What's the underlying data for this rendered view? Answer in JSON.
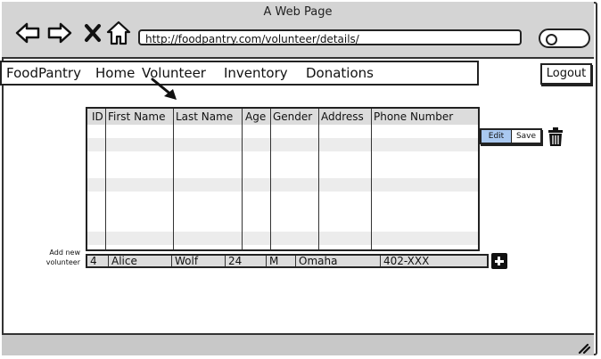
{
  "window": {
    "title": "A Web Page"
  },
  "browser": {
    "url": "http://foodpantry.com/volunteer/details/",
    "icons": [
      "back-arrow-icon",
      "forward-arrow-icon",
      "close-x-icon",
      "home-icon",
      "search-icon"
    ]
  },
  "nav": {
    "brand": "FoodPantry",
    "items": [
      {
        "label": "Home"
      },
      {
        "label": "Volunteer"
      },
      {
        "label": "Inventory"
      },
      {
        "label": "Donations"
      }
    ],
    "logout": "Logout"
  },
  "table": {
    "headers": [
      "ID",
      "First Name",
      "Last Name",
      "Age",
      "Gender",
      "Address",
      "Phone Number"
    ]
  },
  "actions": {
    "edit": "Edit",
    "save": "Save",
    "delete_icon": "trash-icon"
  },
  "add_form": {
    "label_line1": "Add new",
    "label_line2": "volunteer",
    "values": [
      "4",
      "Alice",
      "Wolf",
      "24",
      "M",
      "Omaha",
      "402-XXX"
    ],
    "add_icon": "plus-icon"
  },
  "colors": {
    "chrome": "#d4d4d4",
    "highlight": "#a9c8f0",
    "border": "#222222"
  }
}
